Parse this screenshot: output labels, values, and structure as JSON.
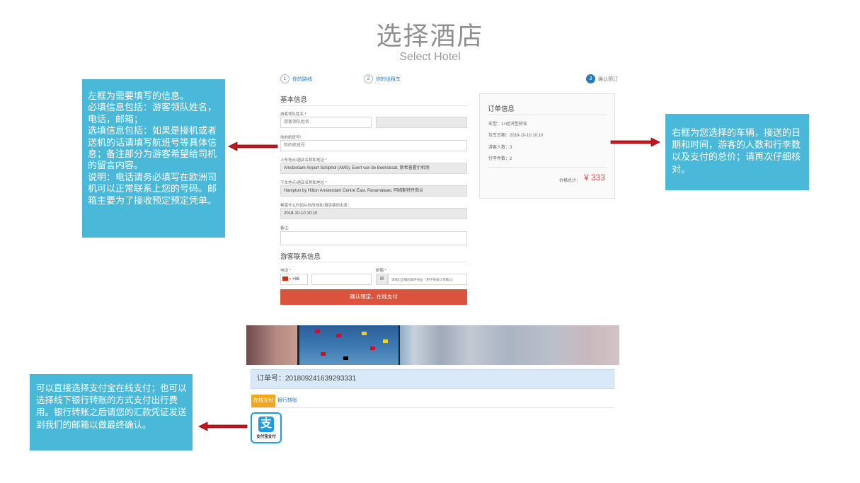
{
  "header": {
    "title": "选择酒店",
    "subtitle": "Select Hotel"
  },
  "steps": [
    {
      "num": "1",
      "label": "你的路线"
    },
    {
      "num": "2",
      "label": "你的出租车"
    },
    {
      "num": "3",
      "label": "确认预订"
    }
  ],
  "form": {
    "basic_heading": "基本信息",
    "leader_name_label": "游客领队姓名 *",
    "leader_name_placeholder": "游客领队姓名",
    "flight_label": "你的航班号！",
    "flight_placeholder": "你的航班号",
    "pickup_label": "上车地点/酒店名称和地址 *",
    "pickup_value": "Amsterdam Airport Schiphol (AMS), Evert van de Beekstraat, 斯希普霍尔机场",
    "dropoff_label": "下车地点/酒店名称和地址 *",
    "dropoff_value": "Hampton by Hilton Amsterdam Centre East, Panamalaan, 阿姆斯特丹荷兰",
    "pickup_time_label": "希望什么时间从你的地址/酒店接你出发：",
    "pickup_time_value": "2018-10-10 10:10",
    "remark_label": "备注:",
    "contact_heading": "游客联系信息",
    "phone_label": "电话 *",
    "phone_code": "+86",
    "email_label": "邮箱 *",
    "email_placeholder": "请填写正确的邮件地址（用于接收订单确认）",
    "confirm_button": "确认预定，在线支付"
  },
  "order_info": {
    "heading": "订单信息",
    "rows": [
      "车型：1×经济型轿车",
      "包车日期：2018-10-10 10:10",
      "游客人数：3",
      "行李件数：2"
    ],
    "price_label": "价格总计：",
    "price_value": "¥ 333"
  },
  "payment": {
    "order_number": "订单号：201809241639293331",
    "tab_online": "在线支付",
    "tab_bank": "银行转账",
    "alipay_glyph": "支",
    "alipay_label": "支付宝支付"
  },
  "notes": {
    "left": [
      "左框为需要填写的信息。",
      "必填信息包括：游客领队姓名，电话，邮箱；",
      "选填信息包括：如果是接机或者送机的话请填写航班号等具体信息；备注部分为游客希望给司机的留言内容。",
      "说明：电话请务必填写在欧洲司机可以正常联系上您的号码。邮箱主要为了接收预定预定凭单。"
    ],
    "right": "右框为您选择的车辆，接送的日期和时间，游客的人数和行李数以及支付的总价；请再次仔细核对。",
    "bottom": "可以直接选择支付宝在线支付；也可以选择线下银行转账的方式支付出行费用。银行转账之后请您的汇款凭证发送到我们的邮箱以做最终确认。"
  },
  "colors": {
    "note_bg": "#4ab8d8",
    "confirm_btn": "#d9533d",
    "price": "#d9534f",
    "tab_online": "#f0a81f",
    "alipay": "#1d9be2",
    "arrow": "#c4161c"
  }
}
